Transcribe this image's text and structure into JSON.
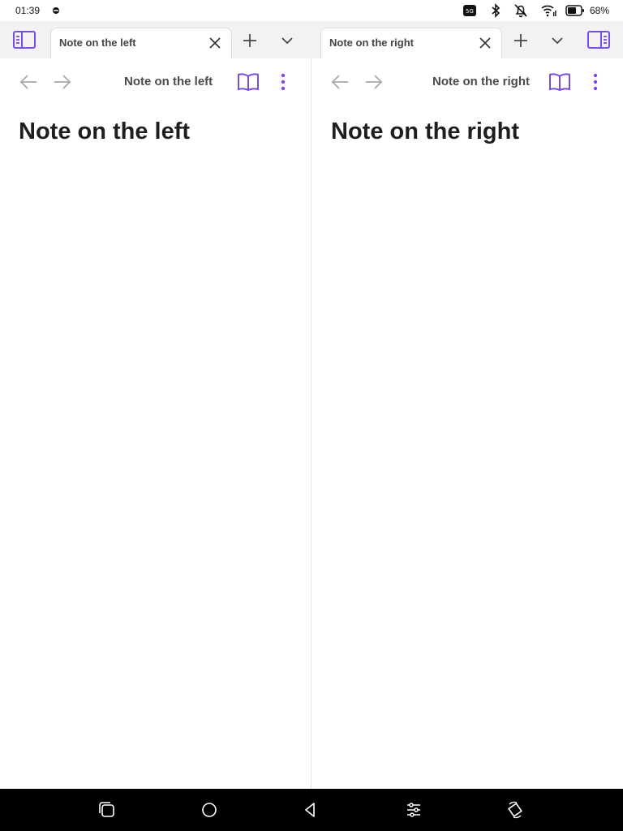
{
  "status_bar": {
    "time": "01:39",
    "battery_percent": "68%",
    "icons": [
      "sync-icon",
      "cast-icon",
      "bluetooth-icon",
      "notifications-off-icon",
      "wifi-icon",
      "battery-icon"
    ]
  },
  "tab_header": {
    "left_tab": {
      "title": "Note on the left"
    },
    "right_tab": {
      "title": "Note on the right"
    },
    "icons": [
      "left-sidebar-toggle-icon",
      "close-icon",
      "new-tab-icon",
      "tab-list-chevron-icon",
      "right-sidebar-toggle-icon"
    ]
  },
  "left_pane": {
    "view_title": "Note on the left",
    "heading": "Note on the left"
  },
  "right_pane": {
    "view_title": "Note on the right",
    "heading": "Note on the right"
  },
  "nav_bar": {
    "icons": [
      "recent-apps-icon",
      "home-icon",
      "back-icon",
      "settings-sliders-icon",
      "screen-rotate-icon"
    ]
  },
  "colors": {
    "accent": "#7b4ce0",
    "nav_arrow": "#a8a8a8",
    "tab_bar_bg": "#f2f2f2"
  }
}
